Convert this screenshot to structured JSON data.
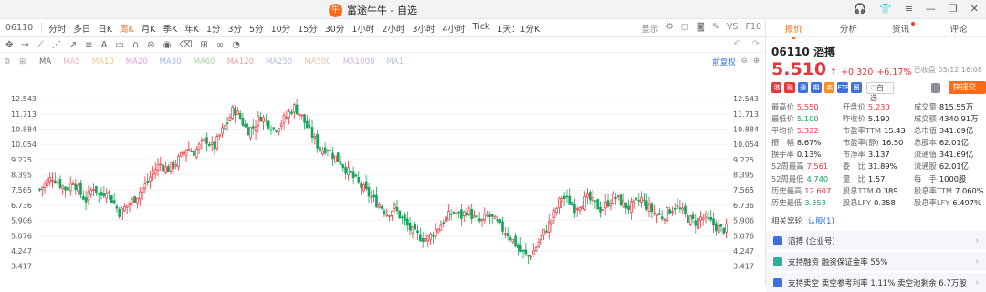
{
  "app": {
    "title": "富途牛牛 - 自选",
    "logo_glyph": "牛",
    "window_buttons": [
      "headset-icon",
      "shirt-icon",
      "tune-icon",
      "minimize-icon",
      "maximize-icon",
      "close-icon"
    ]
  },
  "tabs": {
    "code": "06110",
    "periods": [
      "分时",
      "多日",
      "日K",
      "周K",
      "月K",
      "季K",
      "年K",
      "1分",
      "3分",
      "5分",
      "10分",
      "15分",
      "30分",
      "1小时",
      "2小时",
      "3小时",
      "4小时",
      "Tick",
      "1天：1分K"
    ],
    "active": "周K",
    "right_items": [
      "显示",
      "VS",
      "F10"
    ]
  },
  "ma_bar": {
    "items": [
      {
        "label": "MA",
        "color": "#666666"
      },
      {
        "label": "MA5",
        "color": "#f2b8c6"
      },
      {
        "label": "MA10",
        "color": "#f0c987"
      },
      {
        "label": "MA20",
        "color": "#d6a5e8"
      },
      {
        "label": "MA30",
        "color": "#9fb8e8"
      },
      {
        "label": "MA60",
        "color": "#a7d7a0"
      },
      {
        "label": "MA120",
        "color": "#e8a0a0"
      },
      {
        "label": "MA250",
        "color": "#b0c0e0"
      },
      {
        "label": "MA500",
        "color": "#f0c0a0"
      },
      {
        "label": "MA1000",
        "color": "#c8b0e8"
      },
      {
        "label": "MA1",
        "color": "#b8c4d4"
      }
    ],
    "adjust": "前复权"
  },
  "chart_data": {
    "type": "candlestick",
    "y_ticks": [
      12.543,
      11.713,
      10.884,
      10.054,
      9.225,
      8.395,
      7.565,
      6.736,
      5.906,
      5.076,
      4.247,
      3.417
    ],
    "ylim": [
      3.1,
      13.0
    ],
    "up_color": "#e8353b",
    "down_color": "#1aa35a",
    "close_trend": [
      7.6,
      8.0,
      8.3,
      7.9,
      7.6,
      8.1,
      7.4,
      7.0,
      7.8,
      7.2,
      7.6,
      6.9,
      6.3,
      6.7,
      7.0,
      7.5,
      7.9,
      8.6,
      9.0,
      8.7,
      8.9,
      9.3,
      9.9,
      9.6,
      10.0,
      10.3,
      9.8,
      10.6,
      11.2,
      12.0,
      11.5,
      10.8,
      11.0,
      11.6,
      11.3,
      10.9,
      11.2,
      11.6,
      12.1,
      11.7,
      11.0,
      10.4,
      9.7,
      9.9,
      9.4,
      9.1,
      8.6,
      8.2,
      7.8,
      7.4,
      7.0,
      6.7,
      6.3,
      6.6,
      6.1,
      5.6,
      5.2,
      5.0,
      4.9,
      5.3,
      5.7,
      6.1,
      6.4,
      6.1,
      6.5,
      6.0,
      5.8,
      6.2,
      5.9,
      5.5,
      5.2,
      4.7,
      4.2,
      3.9,
      4.3,
      5.0,
      5.6,
      6.3,
      7.2,
      7.0,
      6.6,
      6.9,
      7.1,
      6.8,
      6.5,
      6.9,
      7.2,
      6.9,
      6.6,
      6.8,
      7.1,
      6.6,
      6.3,
      6.1,
      6.4,
      6.7,
      6.4,
      6.0,
      5.8,
      6.1,
      5.9,
      5.6,
      5.4,
      5.5
    ]
  },
  "panel": {
    "tabs": [
      {
        "label": "报价",
        "active": true
      },
      {
        "label": "分析",
        "active": false
      },
      {
        "label": "资讯",
        "active": false,
        "dot": true
      },
      {
        "label": "评论",
        "active": false
      }
    ],
    "code": "06110",
    "name": "滔搏",
    "price": "5.510",
    "arrow": "↑",
    "change": "+0.320",
    "change_pct": "+6.17%",
    "closed_label": "已收盘 03/12 16:08",
    "fav_label": "自选",
    "trade_label": "快捷交易",
    "badges": [
      {
        "color": "#e8353b",
        "glyph": "港"
      },
      {
        "color": "#e8353b",
        "glyph": "融"
      },
      {
        "color": "#3d6fe0",
        "glyph": "通"
      },
      {
        "color": "#3d6fe0",
        "glyph": "期"
      },
      {
        "color": "#ff8c1a",
        "glyph": "卖"
      },
      {
        "color": "#3d6fe0",
        "glyph": "ETF"
      },
      {
        "color": "#3d6fe0",
        "glyph": "圈"
      }
    ],
    "quote": [
      [
        {
          "k": "最高价",
          "v": "5.550",
          "c": "up"
        },
        {
          "k": "开盘价",
          "v": "5.230",
          "c": "up"
        },
        {
          "k": "成交量",
          "v": "815.55万",
          "c": ""
        }
      ],
      [
        {
          "k": "最低价",
          "v": "5.100",
          "c": "dn"
        },
        {
          "k": "昨收价",
          "v": "5.190",
          "c": ""
        },
        {
          "k": "成交额",
          "v": "4340.91万",
          "c": ""
        }
      ],
      [
        {
          "k": "平均价",
          "v": "5.322",
          "c": "up"
        },
        {
          "k": "市盈率TTM",
          "v": "15.43",
          "c": ""
        },
        {
          "k": "总市值",
          "v": "341.69亿",
          "c": ""
        }
      ],
      [
        {
          "k": "振　幅",
          "v": "8.67%",
          "c": ""
        },
        {
          "k": "市盈率(静)",
          "v": "16.50",
          "c": ""
        },
        {
          "k": "总股本",
          "v": "62.01亿",
          "c": ""
        }
      ],
      [
        {
          "k": "换手率",
          "v": "0.13%",
          "c": ""
        },
        {
          "k": "市净率",
          "v": "3.137",
          "c": ""
        },
        {
          "k": "流通值",
          "v": "341.69亿",
          "c": ""
        }
      ],
      [
        {
          "k": "52周最高",
          "v": "7.561",
          "c": "up"
        },
        {
          "k": "委　比",
          "v": "31.89%",
          "c": ""
        },
        {
          "k": "流通股",
          "v": "62.01亿",
          "c": ""
        }
      ],
      [
        {
          "k": "52周最低",
          "v": "4.740",
          "c": "dn"
        },
        {
          "k": "量　比",
          "v": "1.57",
          "c": ""
        },
        {
          "k": "每　手",
          "v": "1000股",
          "c": ""
        }
      ],
      [
        {
          "k": "历史最高",
          "v": "12.607",
          "c": "up"
        },
        {
          "k": "股息TTM",
          "v": "0.389",
          "c": ""
        },
        {
          "k": "股息率TTM",
          "v": "7.060%",
          "c": ""
        }
      ],
      [
        {
          "k": "历史最低",
          "v": "3.353",
          "c": "dn"
        },
        {
          "k": "股息LFY",
          "v": "0.358",
          "c": ""
        },
        {
          "k": "股息率LFY",
          "v": "6.497%",
          "c": ""
        }
      ]
    ],
    "related": {
      "label": "相关窝轮",
      "link": "认股(1)"
    },
    "news": [
      {
        "text": "滔搏 (企业号)",
        "color": "#3d6fe0"
      },
      {
        "text": "支持融资 融资保证金率 55%",
        "color": "#2bb0a0"
      },
      {
        "text": "支持卖空 卖空参考利率 1.11% 卖空池剩余 6.7万股",
        "color": "#3d6fe0"
      }
    ]
  }
}
